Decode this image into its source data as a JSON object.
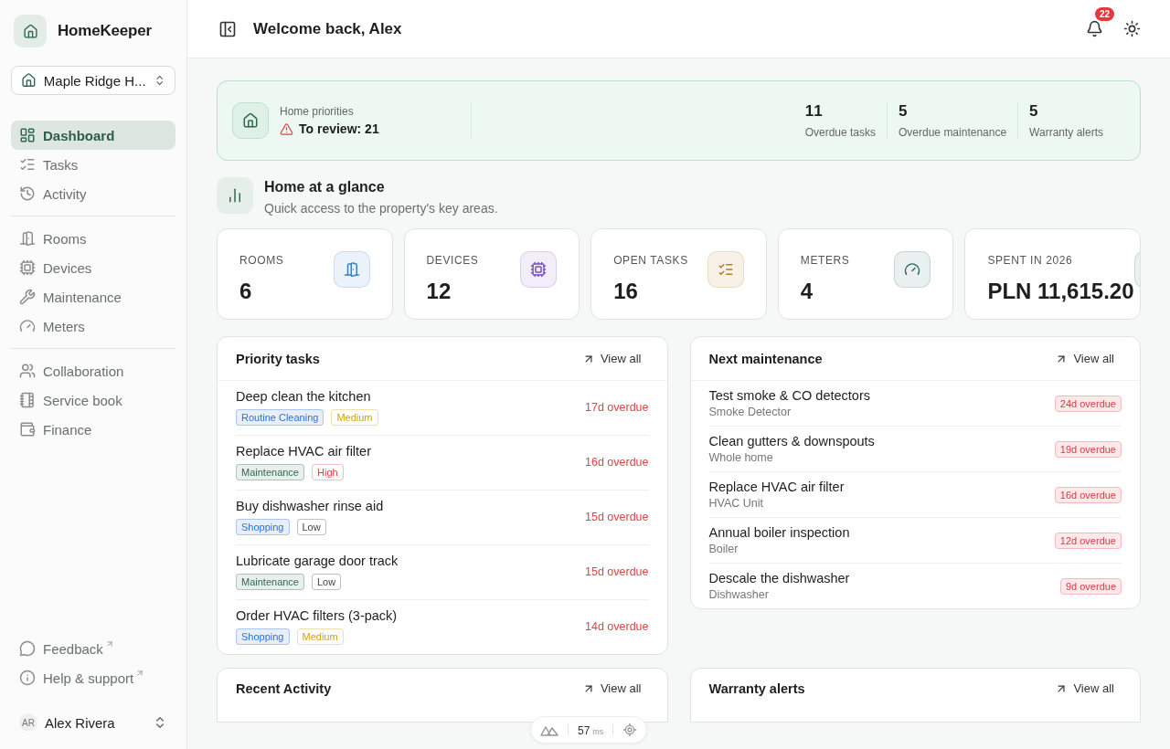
{
  "sidebar": {
    "brand": "HomeKeeper",
    "property": "Maple Ridge H...",
    "nav_groups": [
      [
        {
          "label": "Dashboard",
          "selected": true
        },
        {
          "label": "Tasks",
          "selected": false
        },
        {
          "label": "Activity",
          "selected": false
        }
      ],
      [
        {
          "label": "Rooms",
          "selected": false
        },
        {
          "label": "Devices",
          "selected": false
        },
        {
          "label": "Maintenance",
          "selected": false
        },
        {
          "label": "Meters",
          "selected": false
        }
      ],
      [
        {
          "label": "Collaboration",
          "selected": false
        },
        {
          "label": "Service book",
          "selected": false
        },
        {
          "label": "Finance",
          "selected": false
        }
      ]
    ],
    "footer_links": [
      {
        "label": "Feedback"
      },
      {
        "label": "Help & support"
      }
    ],
    "user": {
      "initials": "AR",
      "name": "Alex Rivera"
    }
  },
  "header": {
    "title": "Welcome back, Alex",
    "notifications": "22"
  },
  "priorities": {
    "label": "Home priorities",
    "review": "To review: 21",
    "stats": [
      {
        "value": "11",
        "label": "Overdue tasks"
      },
      {
        "value": "5",
        "label": "Overdue maintenance"
      },
      {
        "value": "5",
        "label": "Warranty alerts"
      }
    ]
  },
  "glance": {
    "title": "Home at a glance",
    "subtitle": "Quick access to the property's key areas.",
    "cards": [
      {
        "label": "ROOMS",
        "value": "6"
      },
      {
        "label": "DEVICES",
        "value": "12"
      },
      {
        "label": "OPEN TASKS",
        "value": "16"
      },
      {
        "label": "METERS",
        "value": "4"
      },
      {
        "label": "SPENT IN 2026",
        "value": "PLN 11,615.20"
      }
    ]
  },
  "priority_tasks": {
    "title": "Priority tasks",
    "action": "View all",
    "rows": [
      {
        "title": "Deep clean the kitchen",
        "due": "17d overdue",
        "tags": [
          {
            "kind": "category",
            "label": "Routine Cleaning",
            "color": "#2f6fd6"
          },
          {
            "kind": "priority",
            "label": "Medium",
            "color": "#d4a20f"
          }
        ]
      },
      {
        "title": "Replace HVAC air filter",
        "due": "16d overdue",
        "tags": [
          {
            "kind": "category",
            "label": "Maintenance",
            "color": "#2e6b4f"
          },
          {
            "kind": "priority",
            "label": "High",
            "color": "#e0424a"
          }
        ]
      },
      {
        "title": "Buy dishwasher rinse aid",
        "due": "15d overdue",
        "tags": [
          {
            "kind": "category",
            "label": "Shopping",
            "color": "#2f6fd6"
          },
          {
            "kind": "priority",
            "label": "Low",
            "color": "#444444"
          }
        ]
      },
      {
        "title": "Lubricate garage door track",
        "due": "15d overdue",
        "tags": [
          {
            "kind": "category",
            "label": "Maintenance",
            "color": "#2e6b4f"
          },
          {
            "kind": "priority",
            "label": "Low",
            "color": "#444444"
          }
        ]
      },
      {
        "title": "Order HVAC filters (3-pack)",
        "due": "14d overdue",
        "tags": [
          {
            "kind": "category",
            "label": "Shopping",
            "color": "#2f6fd6"
          },
          {
            "kind": "priority",
            "label": "Medium",
            "color": "#d4a20f"
          }
        ]
      }
    ]
  },
  "next_maintenance": {
    "title": "Next maintenance",
    "action": "View all",
    "rows": [
      {
        "title": "Test smoke & CO detectors",
        "subtitle": "Smoke Detector",
        "due": "24d overdue"
      },
      {
        "title": "Clean gutters & downspouts",
        "subtitle": "Whole home",
        "due": "19d overdue"
      },
      {
        "title": "Replace HVAC air filter",
        "subtitle": "HVAC Unit",
        "due": "16d overdue"
      },
      {
        "title": "Annual boiler inspection",
        "subtitle": "Boiler",
        "due": "12d overdue"
      },
      {
        "title": "Descale the dishwasher",
        "subtitle": "Dishwasher",
        "due": "9d overdue"
      }
    ]
  },
  "bottom_panels": [
    {
      "title": "Recent Activity",
      "action": "View all"
    },
    {
      "title": "Warranty alerts",
      "action": "View all"
    }
  ],
  "dev_toolbar": {
    "timing": "57",
    "unit": "ms"
  }
}
